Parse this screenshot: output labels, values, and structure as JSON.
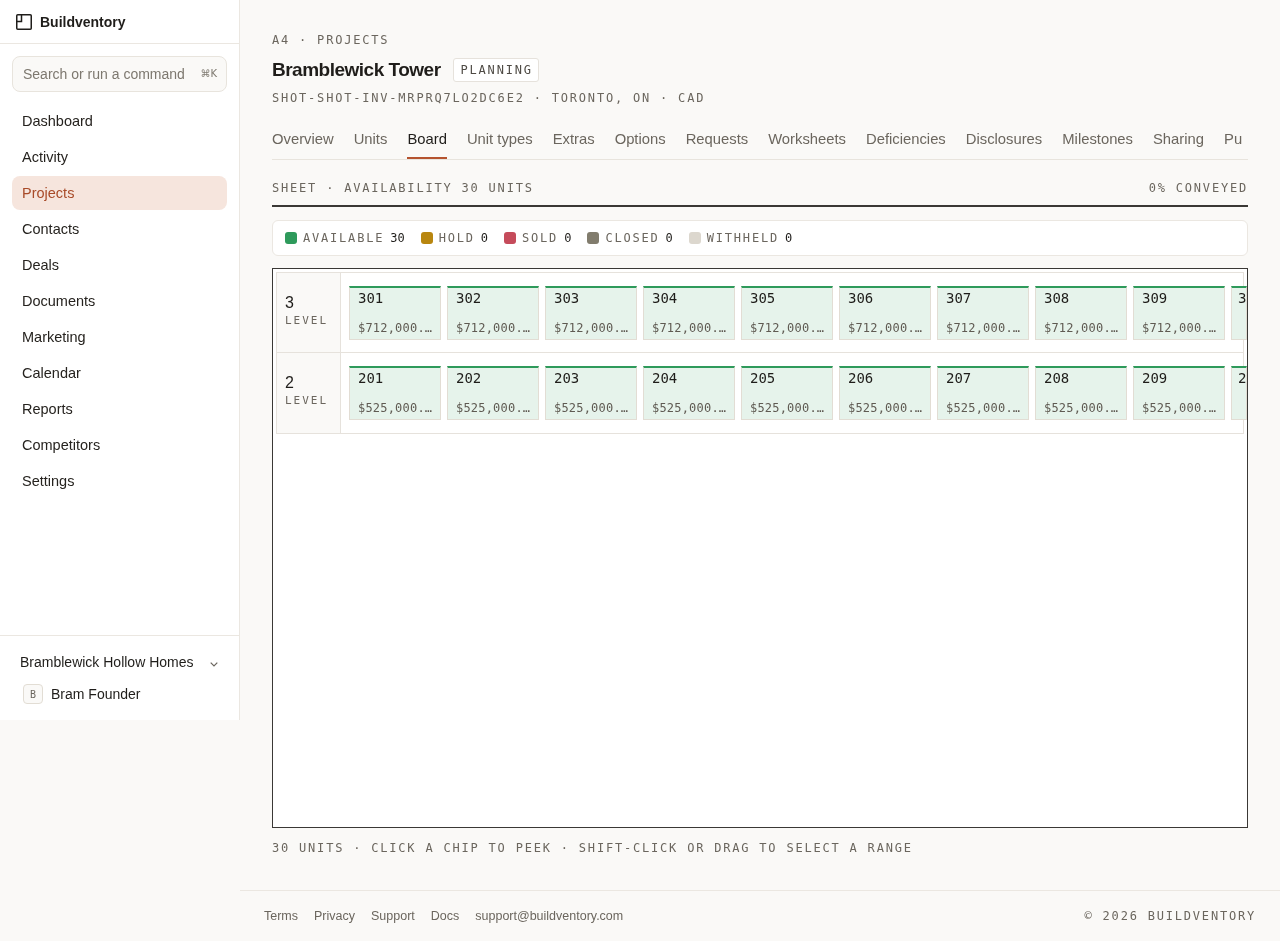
{
  "sidebar": {
    "brand": "Buildventory",
    "search": {
      "placeholder": "Search or run a command",
      "shortcut": "⌘K"
    },
    "items": [
      {
        "label": "Dashboard",
        "selected": false
      },
      {
        "label": "Activity",
        "selected": false
      },
      {
        "label": "Projects",
        "selected": true
      },
      {
        "label": "Contacts",
        "selected": false
      },
      {
        "label": "Deals",
        "selected": false
      },
      {
        "label": "Documents",
        "selected": false
      },
      {
        "label": "Marketing",
        "selected": false
      },
      {
        "label": "Calendar",
        "selected": false
      },
      {
        "label": "Reports",
        "selected": false
      },
      {
        "label": "Competitors",
        "selected": false
      },
      {
        "label": "Settings",
        "selected": false
      }
    ],
    "workspace": "Bramblewick Hollow Homes",
    "user": {
      "initial": "B",
      "name": "Bram Founder"
    }
  },
  "header": {
    "breadcrumb": "A4 · PROJECTS",
    "title": "Bramblewick Tower",
    "status": "PLANNING",
    "meta": "SHOT-SHOT-INV-MRPRQ7LO2DC6E2 · TORONTO, ON · CAD"
  },
  "tabs": [
    {
      "label": "Overview",
      "selected": false
    },
    {
      "label": "Units",
      "selected": false
    },
    {
      "label": "Board",
      "selected": true
    },
    {
      "label": "Unit types",
      "selected": false
    },
    {
      "label": "Extras",
      "selected": false
    },
    {
      "label": "Options",
      "selected": false
    },
    {
      "label": "Requests",
      "selected": false
    },
    {
      "label": "Worksheets",
      "selected": false
    },
    {
      "label": "Deficiencies",
      "selected": false
    },
    {
      "label": "Disclosures",
      "selected": false
    },
    {
      "label": "Milestones",
      "selected": false
    },
    {
      "label": "Sharing",
      "selected": false
    },
    {
      "label": "Pu",
      "selected": false
    }
  ],
  "sheet": {
    "title": "SHEET · AVAILABILITY 30 UNITS",
    "conveyed": "0% CONVEYED"
  },
  "legend": [
    {
      "label": "AVAILABLE",
      "count": "30",
      "color": "#2e9a5b"
    },
    {
      "label": "HOLD",
      "count": "0",
      "color": "#b8860f"
    },
    {
      "label": "SOLD",
      "count": "0",
      "color": "#c54b5b"
    },
    {
      "label": "CLOSED",
      "count": "0",
      "color": "#817c6d"
    },
    {
      "label": "WITHHELD",
      "count": "0",
      "color": "#dcd7ce"
    }
  ],
  "board": {
    "levels": [
      {
        "number": "3",
        "label": "LEVEL",
        "units": [
          {
            "unit": "301",
            "price": "$712,000.…",
            "color": "#2e9a5b"
          },
          {
            "unit": "302",
            "price": "$712,000.…",
            "color": "#2e9a5b"
          },
          {
            "unit": "303",
            "price": "$712,000.…",
            "color": "#2e9a5b"
          },
          {
            "unit": "304",
            "price": "$712,000.…",
            "color": "#2e9a5b"
          },
          {
            "unit": "305",
            "price": "$712,000.…",
            "color": "#2e9a5b"
          },
          {
            "unit": "306",
            "price": "$712,000.…",
            "color": "#2e9a5b"
          },
          {
            "unit": "307",
            "price": "$712,000.…",
            "color": "#2e9a5b"
          },
          {
            "unit": "308",
            "price": "$712,000.…",
            "color": "#2e9a5b"
          },
          {
            "unit": "309",
            "price": "$712,000.…",
            "color": "#2e9a5b"
          },
          {
            "unit": "3",
            "color": "#2e9a5b"
          }
        ]
      },
      {
        "number": "2",
        "label": "LEVEL",
        "units": [
          {
            "unit": "201",
            "price": "$525,000.…",
            "color": "#2e9a5b"
          },
          {
            "unit": "202",
            "price": "$525,000.…",
            "color": "#2e9a5b"
          },
          {
            "unit": "203",
            "price": "$525,000.…",
            "color": "#2e9a5b"
          },
          {
            "unit": "204",
            "price": "$525,000.…",
            "color": "#2e9a5b"
          },
          {
            "unit": "205",
            "price": "$525,000.…",
            "color": "#2e9a5b"
          },
          {
            "unit": "206",
            "price": "$525,000.…",
            "color": "#2e9a5b"
          },
          {
            "unit": "207",
            "price": "$525,000.…",
            "color": "#2e9a5b"
          },
          {
            "unit": "208",
            "price": "$525,000.…",
            "color": "#2e9a5b"
          },
          {
            "unit": "209",
            "price": "$525,000.…",
            "color": "#2e9a5b"
          },
          {
            "unit": "2",
            "color": "#2e9a5b"
          }
        ]
      }
    ]
  },
  "hint": "30 UNITS · CLICK A CHIP TO PEEK · SHIFT-CLICK OR DRAG TO SELECT A RANGE",
  "footer": {
    "links": [
      "Terms",
      "Privacy",
      "Support",
      "Docs",
      "support@buildventory.com"
    ],
    "copyright": "© 2026 BUILDVENTORY"
  }
}
